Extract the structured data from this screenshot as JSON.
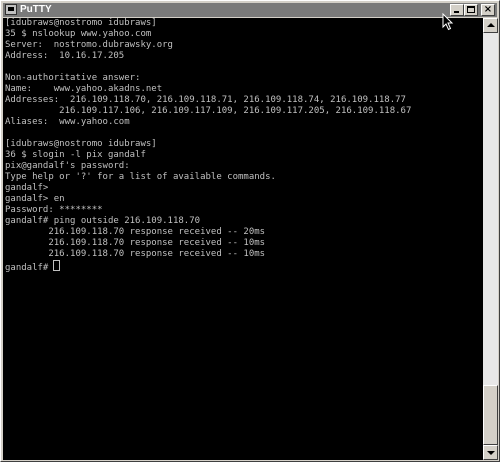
{
  "window": {
    "title": "PuTTY",
    "buttons": {
      "minimize": "minimize",
      "maximize": "maximize",
      "close": "×"
    }
  },
  "terminal": {
    "lines": [
      "[idubraws@nostromo idubraws]",
      "35 $ nslookup www.yahoo.com",
      "Server:  nostromo.dubrawsky.org",
      "Address:  10.16.17.205",
      "",
      "Non-authoritative answer:",
      "Name:    www.yahoo.akadns.net",
      "Addresses:  216.109.118.70, 216.109.118.71, 216.109.118.74, 216.109.118.77",
      "          216.109.117.106, 216.109.117.109, 216.109.117.205, 216.109.118.67",
      "Aliases:  www.yahoo.com",
      "",
      "[idubraws@nostromo idubraws]",
      "36 $ slogin -l pix gandalf",
      "pix@gandalf's password:",
      "Type help or '?' for a list of available commands.",
      "gandalf>",
      "gandalf> en",
      "Password: ********",
      "gandalf# ping outside 216.109.118.70",
      "        216.109.118.70 response received -- 20ms",
      "        216.109.118.70 response received -- 10ms",
      "        216.109.118.70 response received -- 10ms",
      "gandalf#"
    ],
    "colors": {
      "background": "#000000",
      "foreground": "#c0c0c0"
    }
  },
  "icons": {
    "app": "putty-icon",
    "pointer": "mouse-pointer-icon"
  }
}
